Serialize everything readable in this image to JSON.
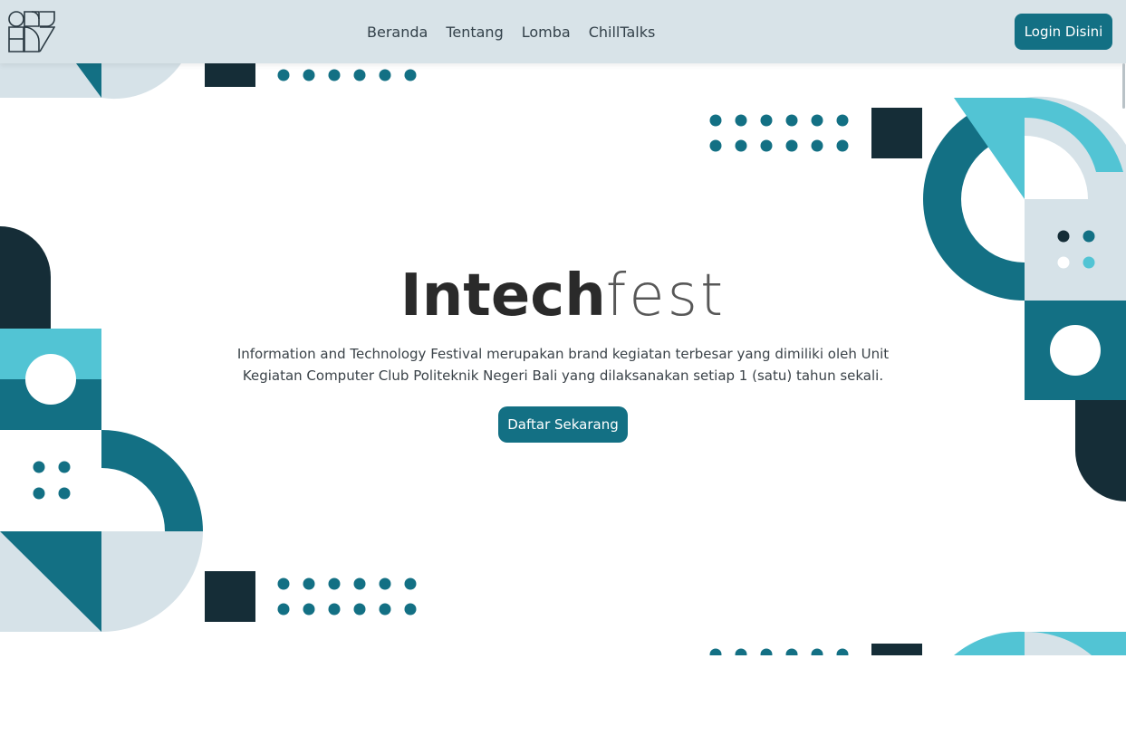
{
  "brand": {
    "logo_icon": "intechfest-logo-icon"
  },
  "nav": {
    "links": [
      "Beranda",
      "Tentang",
      "Lomba",
      "ChillTalks"
    ],
    "login_label": "Login Disini"
  },
  "hero": {
    "title_bold": "Intech",
    "title_light": "fest",
    "description": "Information and Technology Festival merupakan brand kegiatan terbesar yang dimiliki oleh Unit Kegiatan Computer Club Politeknik Negeri Bali yang dilaksanakan setiap 1 (satu) tahun sekali.",
    "cta_label": "Daftar Sekarang"
  },
  "colors": {
    "dark": "#152d37",
    "teal": "#137084",
    "cyan": "#52c4d4",
    "light": "#d6e2e8",
    "navbar": "#d8e3e8"
  }
}
